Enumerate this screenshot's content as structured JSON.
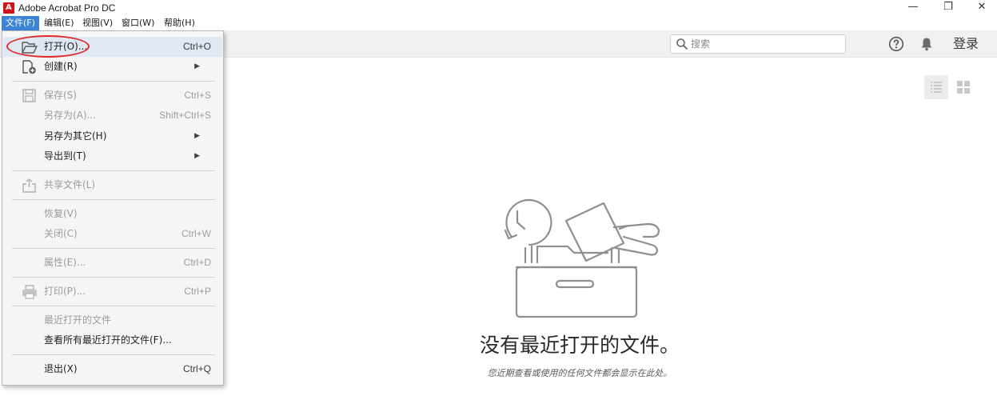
{
  "window": {
    "title": "Adobe Acrobat Pro DC",
    "logo_text": "A",
    "minimize": "—",
    "maximize": "❐",
    "close": "✕"
  },
  "menubar": [
    {
      "label": "文件(F)"
    },
    {
      "label": "编辑(E)"
    },
    {
      "label": "视图(V)"
    },
    {
      "label": "窗口(W)"
    },
    {
      "label": "帮助(H)"
    }
  ],
  "toolbar": {
    "search_placeholder": "搜索",
    "login_label": "登录"
  },
  "file_menu": {
    "open": {
      "label": "打开(O)...",
      "shortcut": "Ctrl+O"
    },
    "create": {
      "label": "创建(R)",
      "arrow": "▶"
    },
    "save": {
      "label": "保存(S)",
      "shortcut": "Ctrl+S"
    },
    "save_as": {
      "label": "另存为(A)...",
      "shortcut": "Shift+Ctrl+S"
    },
    "save_as_other": {
      "label": "另存为其它(H)",
      "arrow": "▶"
    },
    "export_to": {
      "label": "导出到(T)",
      "arrow": "▶"
    },
    "share": {
      "label": "共享文件(L)"
    },
    "revert": {
      "label": "恢复(V)"
    },
    "close": {
      "label": "关闭(C)",
      "shortcut": "Ctrl+W"
    },
    "properties": {
      "label": "属性(E)...",
      "shortcut": "Ctrl+D"
    },
    "print": {
      "label": "打印(P)...",
      "shortcut": "Ctrl+P"
    },
    "recent_files": {
      "label": "最近打开的文件"
    },
    "view_all_recent": {
      "label": "查看所有最近打开的文件(F)..."
    },
    "exit": {
      "label": "退出(X)",
      "shortcut": "Ctrl+Q"
    }
  },
  "empty_state": {
    "title": "没有最近打开的文件。",
    "subtitle": "您近期查看或使用的任何文件都会显示在此处。"
  },
  "colors": {
    "menu_active": "#3c84d6",
    "annotation_circle": "#e02b2b",
    "acrobat_red": "#d4121c"
  }
}
